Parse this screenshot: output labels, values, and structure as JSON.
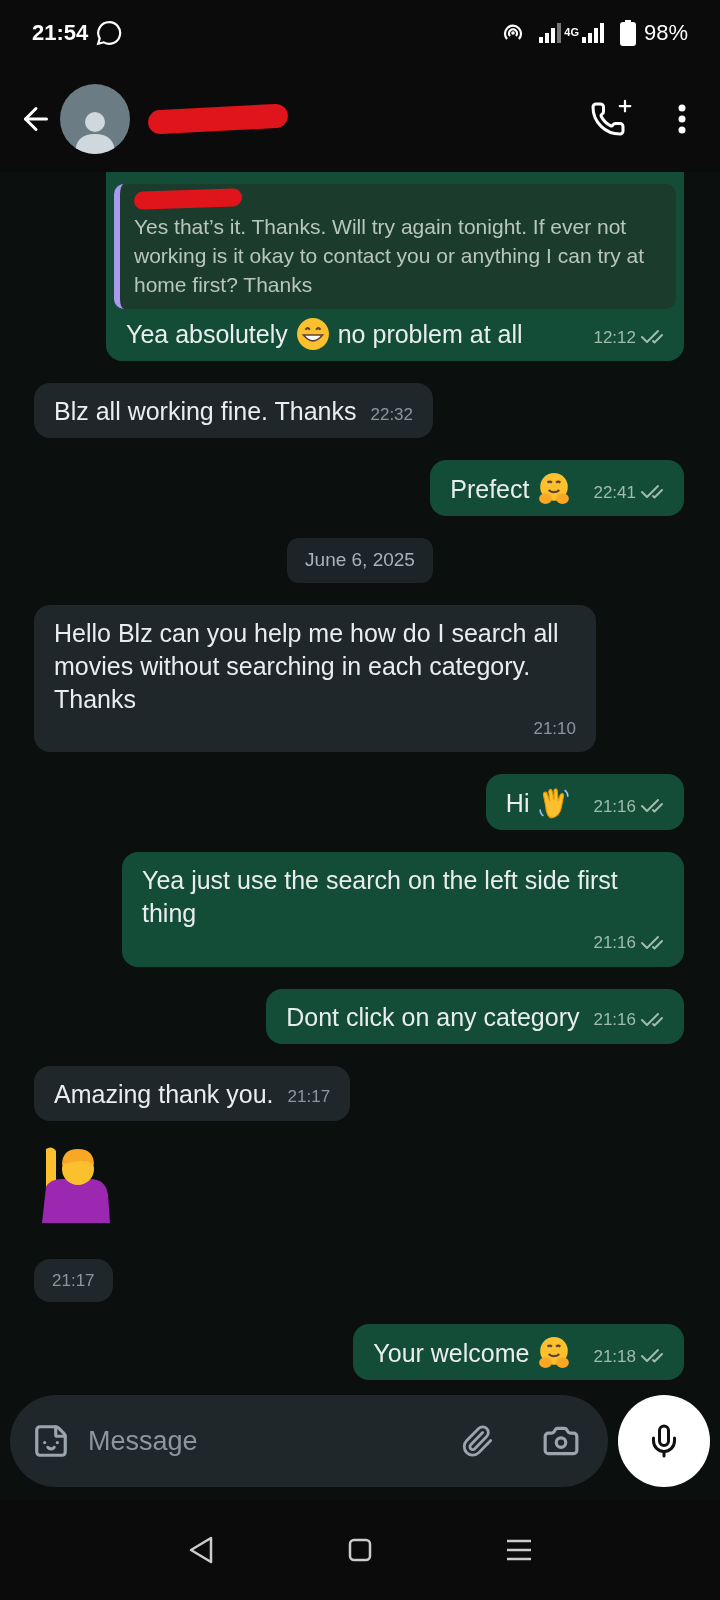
{
  "status_bar": {
    "time": "21:54",
    "network": "4G",
    "battery": "98%"
  },
  "messages": [
    {
      "kind": "message",
      "outgoing": true,
      "cut": true,
      "quote": {
        "text": "Yes that’s it. Thanks. Will try again tonight. If ever not working is it okay to contact you or anything I can try at home first? Thanks"
      },
      "segments": [
        {
          "kind": "text",
          "text": "Yea absolutely"
        },
        {
          "kind": "grinning_face"
        },
        {
          "kind": "text",
          "text": "no problem at all"
        }
      ],
      "time": "12:12",
      "read": false
    },
    {
      "kind": "message",
      "outgoing": false,
      "segments": [
        {
          "kind": "text",
          "text": "Blz all working fine. Thanks"
        }
      ],
      "time": "22:32"
    },
    {
      "kind": "message",
      "outgoing": true,
      "segments": [
        {
          "kind": "text",
          "text": "Prefect"
        },
        {
          "kind": "hugging_face"
        }
      ],
      "time": "22:41",
      "read": false
    },
    {
      "kind": "date",
      "text": "June 6, 2025"
    },
    {
      "kind": "message",
      "outgoing": false,
      "segments": [
        {
          "kind": "text",
          "text": "Hello Blz can you help me how do I search all movies without searching in each category. Thanks"
        }
      ],
      "time": "21:10"
    },
    {
      "kind": "message",
      "outgoing": true,
      "segments": [
        {
          "kind": "text",
          "text": "Hi"
        },
        {
          "kind": "waving_hand"
        }
      ],
      "time": "21:16",
      "read": false
    },
    {
      "kind": "message",
      "outgoing": true,
      "segments": [
        {
          "kind": "text",
          "text": "Yea just use the search on the left side first thing"
        }
      ],
      "time": "21:16",
      "read": false
    },
    {
      "kind": "message",
      "outgoing": true,
      "segments": [
        {
          "kind": "text",
          "text": "Dont click on any category"
        }
      ],
      "time": "21:16",
      "read": false
    },
    {
      "kind": "message",
      "outgoing": false,
      "segments": [
        {
          "kind": "text",
          "text": "Amazing thank you."
        }
      ],
      "time": "21:17"
    },
    {
      "kind": "sticker",
      "outgoing": false,
      "segments": [
        {
          "kind": "raising_hand"
        }
      ],
      "time": "21:17"
    },
    {
      "kind": "message",
      "outgoing": true,
      "segments": [
        {
          "kind": "text",
          "text": "Your welcome"
        },
        {
          "kind": "hugging_face"
        }
      ],
      "time": "21:18",
      "read": false
    }
  ],
  "composer": {
    "placeholder": "Message"
  }
}
